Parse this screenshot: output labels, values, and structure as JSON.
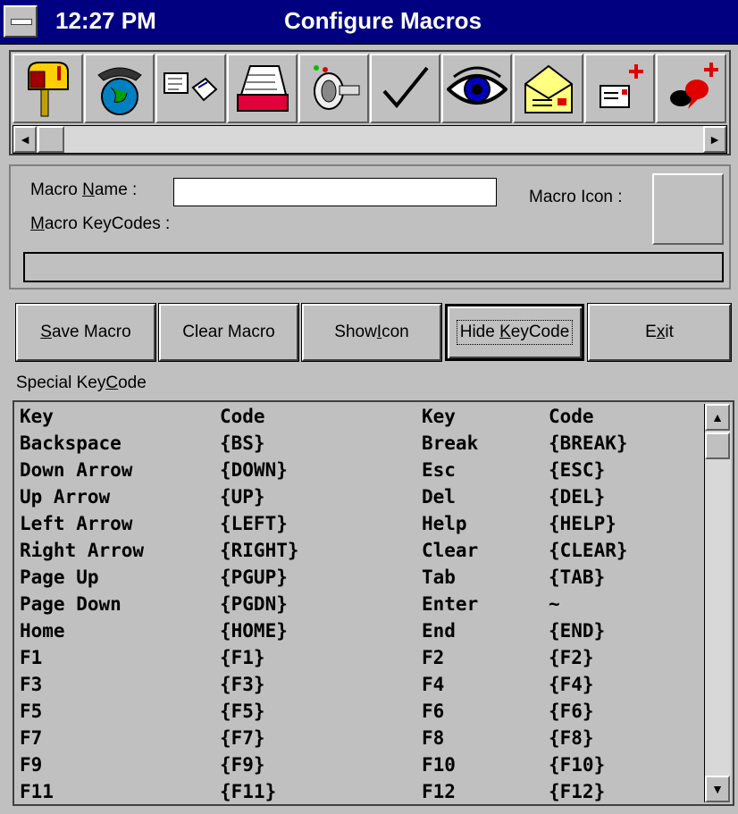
{
  "titlebar": {
    "clock": "12:27 PM",
    "title": "Configure Macros"
  },
  "toolbar": {
    "icons": [
      "mailbox-icon",
      "globe-phone-icon",
      "cards-icon",
      "rolodex-icon",
      "key-icon",
      "checkmark-icon",
      "eye-icon",
      "envelope-icon",
      "new-message-icon",
      "new-chat-icon"
    ],
    "scroll_left": "◄",
    "scroll_right": "►"
  },
  "form": {
    "name_label_pre": "Macro ",
    "name_label_u": "N",
    "name_label_post": "ame :",
    "name_value": "",
    "keycodes_label_u": "M",
    "keycodes_label_post": "acro KeyCodes :",
    "icon_label": "Macro Icon :"
  },
  "buttons": [
    {
      "u": "S",
      "rest": "ave Macro",
      "pre": ""
    },
    {
      "pre": "Clear Macro",
      "u": "",
      "rest": ""
    },
    {
      "pre": "Show ",
      "u": "I",
      "rest": "con"
    },
    {
      "pre": "Hide ",
      "u": "K",
      "rest": "eyCode"
    },
    {
      "pre": "E",
      "u": "x",
      "rest": "it"
    }
  ],
  "special": {
    "pre": "Special Key",
    "u": "C",
    "post": "ode"
  },
  "table": {
    "rows": [
      [
        "Key",
        "Code",
        "Key",
        "Code"
      ],
      [
        "Backspace",
        "{BS}",
        "Break",
        "{BREAK}"
      ],
      [
        "Down Arrow",
        "{DOWN}",
        "Esc",
        "{ESC}"
      ],
      [
        "Up Arrow",
        "{UP}",
        "Del",
        "{DEL}"
      ],
      [
        "Left Arrow",
        "{LEFT}",
        "Help",
        "{HELP}"
      ],
      [
        "Right Arrow",
        "{RIGHT}",
        "Clear",
        "{CLEAR}"
      ],
      [
        "Page Up",
        "{PGUP}",
        "Tab",
        "{TAB}"
      ],
      [
        "Page Down",
        "{PGDN}",
        "Enter",
        "~"
      ],
      [
        "Home",
        "{HOME}",
        "End",
        "{END}"
      ],
      [
        "F1",
        "{F1}",
        "F2",
        "{F2}"
      ],
      [
        "F3",
        "{F3}",
        "F4",
        "{F4}"
      ],
      [
        "F5",
        "{F5}",
        "F6",
        "{F6}"
      ],
      [
        "F7",
        "{F7}",
        "F8",
        "{F8}"
      ],
      [
        "F9",
        "{F9}",
        "F10",
        "{F10}"
      ],
      [
        "F11",
        "{F11}",
        "F12",
        "{F12}"
      ]
    ],
    "scroll_up": "▲",
    "scroll_down": "▼"
  },
  "colors": {
    "titlebar": "#000080",
    "face": "#c0c0c0"
  }
}
